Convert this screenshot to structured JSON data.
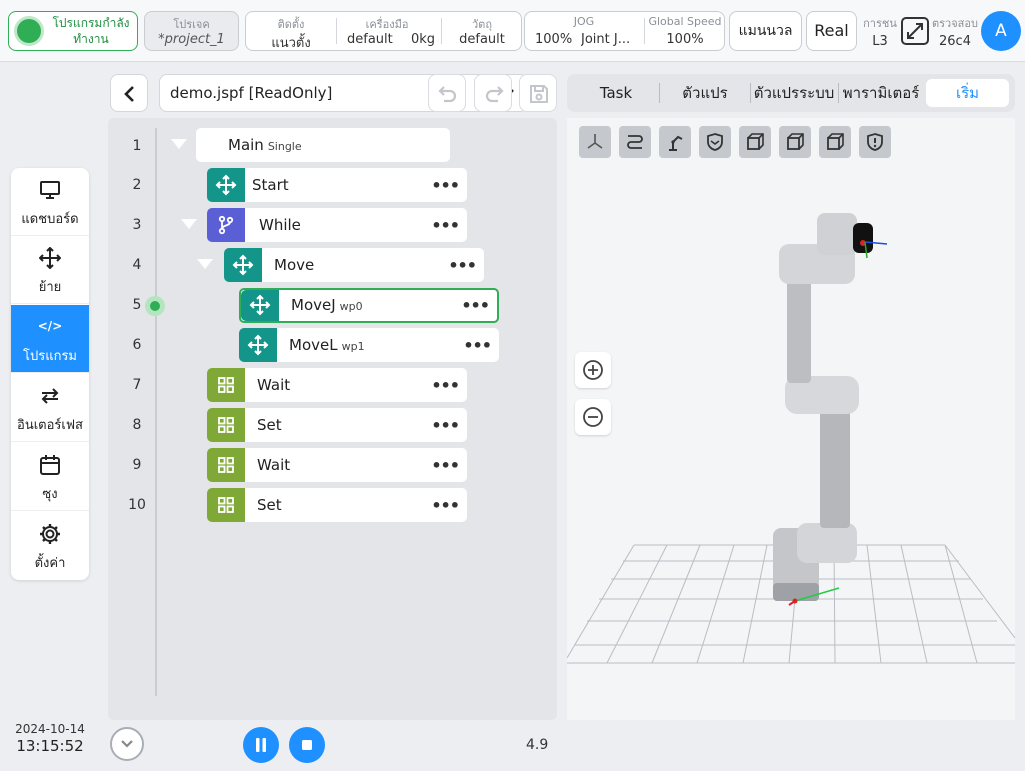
{
  "topbar": {
    "status": "โปรแกรมกำลังทำงาน",
    "project_label": "โปรเจค",
    "project_value": "*project_1",
    "install_label": "ติดตั้ง",
    "install_value": "แนวตั้ง",
    "tool_label": "เครื่องมือ",
    "tool_value": "default",
    "tool_weight": "0kg",
    "material_label": "วัตถุ",
    "material_value": "default",
    "jog_label": "JOG",
    "jog_percent": "100%",
    "jog_mode": "Joint J...",
    "global_speed_label": "Global Speed",
    "global_speed_value": "100%",
    "manual_button": "แมนนวล",
    "real_button": "Real",
    "level_label": "การชน",
    "level_value": "L3",
    "check_label": "ตรวจสอบ",
    "check_value": "26c4",
    "avatar_letter": "A"
  },
  "sidebar": {
    "items": [
      {
        "label": "แดชบอร์ด",
        "icon": "monitor-icon"
      },
      {
        "label": "ย้าย",
        "icon": "move-icon"
      },
      {
        "label": "โปรแกรม",
        "icon": "code-icon",
        "glyph": "</>",
        "active": true
      },
      {
        "label": "อินเตอร์เฟส",
        "icon": "swap-icon"
      },
      {
        "label": "ซุง",
        "icon": "calendar-icon"
      },
      {
        "label": "ตั้งค่า",
        "icon": "gear-icon"
      }
    ],
    "date": "2024-10-14",
    "time": "13:15:52"
  },
  "program": {
    "file_name": "demo.jspf [ReadOnly]",
    "speed": "4.9",
    "lines": [
      {
        "no": "1",
        "name": "Main",
        "sub": "Single"
      },
      {
        "no": "2",
        "name": "Start",
        "sub": ""
      },
      {
        "no": "3",
        "name": "While",
        "sub": ""
      },
      {
        "no": "4",
        "name": "Move",
        "sub": ""
      },
      {
        "no": "5",
        "name": "MoveJ",
        "sub": "wp0"
      },
      {
        "no": "6",
        "name": "MoveL",
        "sub": "wp1"
      },
      {
        "no": "7",
        "name": "Wait",
        "sub": ""
      },
      {
        "no": "8",
        "name": "Set",
        "sub": ""
      },
      {
        "no": "9",
        "name": "Wait",
        "sub": ""
      },
      {
        "no": "10",
        "name": "Set",
        "sub": ""
      }
    ]
  },
  "tabs": [
    "Task",
    "ตัวแปร",
    "ตัวแปรระบบ",
    "พารามิเตอร์",
    "เริ่ม"
  ],
  "colors": {
    "accent": "#1e90ff",
    "running": "#2fae55",
    "move_node": "#14958a",
    "while_node": "#5a5fd6",
    "misc_node": "#7fa836"
  }
}
